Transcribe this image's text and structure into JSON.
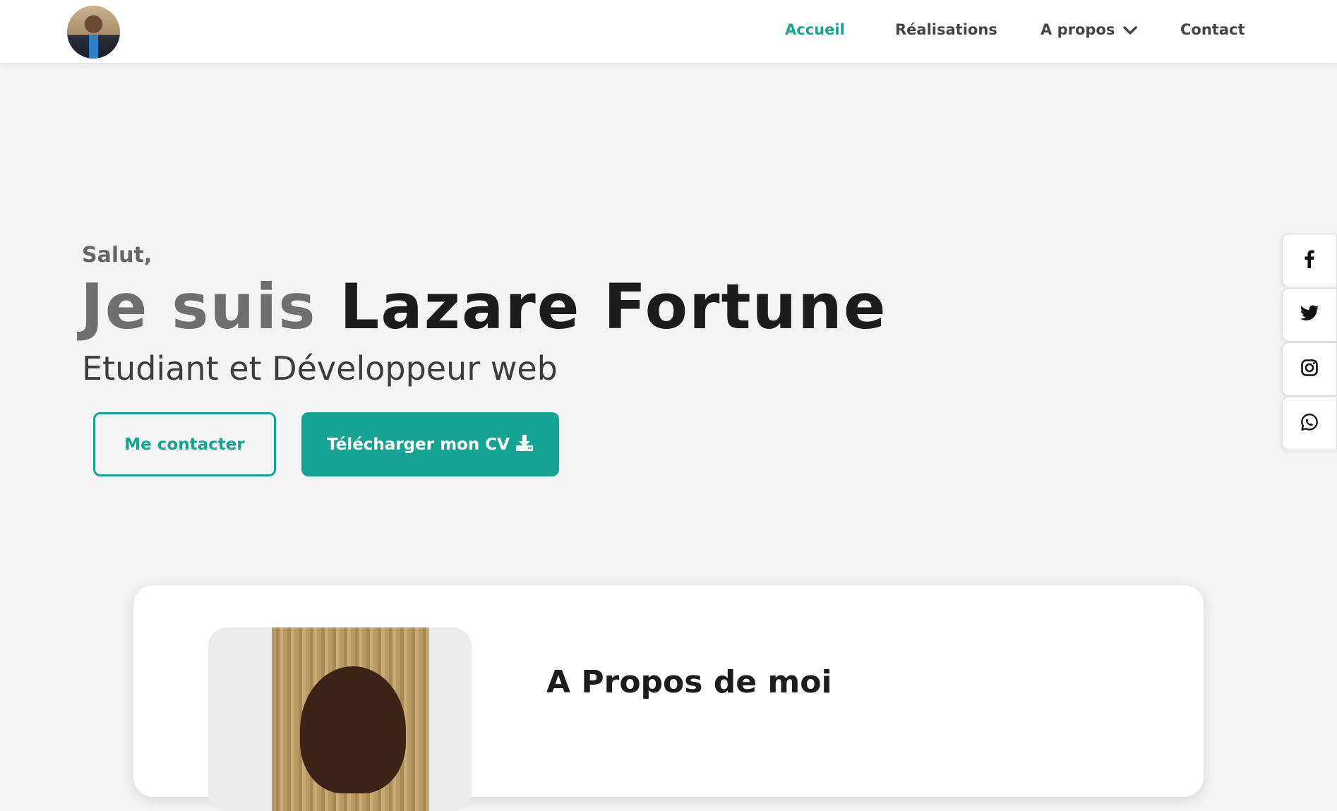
{
  "header": {
    "nav": [
      {
        "label": "Accueil",
        "active": true
      },
      {
        "label": "Réalisations",
        "active": false
      },
      {
        "label": "A propos",
        "active": false,
        "has_dropdown": true
      },
      {
        "label": "Contact",
        "active": false
      }
    ]
  },
  "hero": {
    "greeting": "Salut,",
    "headline_prefix": "Je suis",
    "name": "Lazare Fortune",
    "role": "Etudiant et Développeur web",
    "contact_button": "Me contacter",
    "cv_button": "Télécharger mon CV"
  },
  "social": [
    {
      "icon": "facebook-icon"
    },
    {
      "icon": "twitter-icon"
    },
    {
      "icon": "instagram-icon"
    },
    {
      "icon": "whatsapp-icon"
    }
  ],
  "about": {
    "title": "A Propos de moi"
  },
  "colors": {
    "accent": "#17a392",
    "background": "#f4f4f4",
    "text_dark": "#1c1c1c",
    "text_muted": "#6f6f6f"
  }
}
